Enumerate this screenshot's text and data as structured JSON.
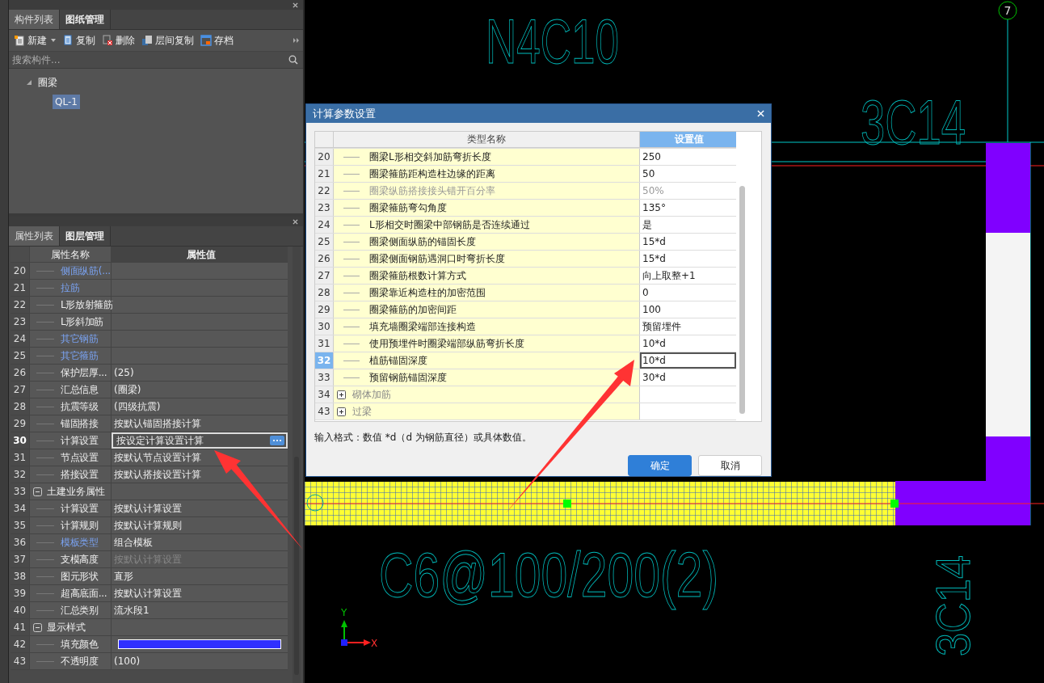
{
  "component_panel": {
    "tabs": [
      {
        "label": "构件列表",
        "selected": true
      },
      {
        "label": "图纸管理",
        "selected": false
      }
    ],
    "toolbar": [
      {
        "label": "新建",
        "kind": "new",
        "dropdown": true
      },
      {
        "label": "复制",
        "kind": "copy",
        "dropdown": false
      },
      {
        "label": "删除",
        "kind": "delete",
        "dropdown": false
      },
      {
        "label": "层间复制",
        "kind": "floor_copy",
        "dropdown": false
      },
      {
        "label": "存档",
        "kind": "archive",
        "dropdown": false
      }
    ],
    "search": {
      "placeholder": "搜索构件..."
    },
    "tree": [
      {
        "label": "圈梁",
        "expanded": true,
        "children": [
          {
            "label": "QL-1",
            "selected": true
          }
        ]
      }
    ]
  },
  "property_panel": {
    "tabs": [
      {
        "label": "属性列表",
        "selected": true
      },
      {
        "label": "图层管理",
        "selected": false
      }
    ],
    "columns": [
      "属性名称",
      "属性值"
    ],
    "rows": [
      {
        "index": "20",
        "kind": "child",
        "name": "侧面纵筋(...",
        "value": "",
        "link": true,
        "disabled": false,
        "selected": false
      },
      {
        "index": "21",
        "kind": "child",
        "name": "拉筋",
        "value": "",
        "link": true,
        "disabled": false,
        "selected": false
      },
      {
        "index": "22",
        "kind": "child",
        "name": "L形放射箍筋",
        "value": "",
        "link": false,
        "disabled": false,
        "selected": false
      },
      {
        "index": "23",
        "kind": "child",
        "name": "L形斜加筋",
        "value": "",
        "link": false,
        "disabled": false,
        "selected": false
      },
      {
        "index": "24",
        "kind": "child",
        "name": "其它钢筋",
        "value": "",
        "link": true,
        "disabled": false,
        "selected": false
      },
      {
        "index": "25",
        "kind": "child",
        "name": "其它箍筋",
        "value": "",
        "link": true,
        "disabled": false,
        "selected": false
      },
      {
        "index": "26",
        "kind": "child",
        "name": "保护层厚...",
        "value": "(25)",
        "link": false,
        "disabled": false,
        "selected": false
      },
      {
        "index": "27",
        "kind": "child",
        "name": "汇总信息",
        "value": "(圈梁)",
        "link": false,
        "disabled": false,
        "selected": false
      },
      {
        "index": "28",
        "kind": "child",
        "name": "抗震等级",
        "value": "(四级抗震)",
        "link": false,
        "disabled": false,
        "selected": false
      },
      {
        "index": "29",
        "kind": "child",
        "name": "锚固搭接",
        "value": "按默认锚固搭接计算",
        "link": false,
        "disabled": false,
        "selected": false
      },
      {
        "index": "30",
        "kind": "child",
        "name": "计算设置",
        "value": "按设定计算设置计算",
        "link": false,
        "disabled": false,
        "selected": true
      },
      {
        "index": "31",
        "kind": "child",
        "name": "节点设置",
        "value": "按默认节点设置计算",
        "link": false,
        "disabled": false,
        "selected": false
      },
      {
        "index": "32",
        "kind": "child",
        "name": "搭接设置",
        "value": "按默认搭接设置计算",
        "link": false,
        "disabled": false,
        "selected": false
      },
      {
        "index": "33",
        "kind": "group",
        "name": "土建业务属性",
        "value": "",
        "expanded": true,
        "selected": false
      },
      {
        "index": "34",
        "kind": "child",
        "name": "计算设置",
        "value": "按默认计算设置",
        "link": false,
        "disabled": false,
        "selected": false
      },
      {
        "index": "35",
        "kind": "child",
        "name": "计算规则",
        "value": "按默认计算规则",
        "link": false,
        "disabled": false,
        "selected": false
      },
      {
        "index": "36",
        "kind": "child",
        "name": "模板类型",
        "value": "组合模板",
        "link": true,
        "disabled": false,
        "selected": false
      },
      {
        "index": "37",
        "kind": "child",
        "name": "支模高度",
        "value": "按默认计算设置",
        "link": false,
        "disabled": true,
        "selected": false
      },
      {
        "index": "38",
        "kind": "child",
        "name": "图元形状",
        "value": "直形",
        "link": false,
        "disabled": false,
        "selected": false
      },
      {
        "index": "39",
        "kind": "child",
        "name": "超高底面...",
        "value": "按默认计算设置",
        "link": false,
        "disabled": false,
        "selected": false
      },
      {
        "index": "40",
        "kind": "child",
        "name": "汇总类别",
        "value": "流水段1",
        "link": false,
        "disabled": false,
        "selected": false
      },
      {
        "index": "41",
        "kind": "group",
        "name": "显示样式",
        "value": "",
        "expanded": true,
        "selected": false
      },
      {
        "index": "42",
        "kind": "color",
        "name": "填充颜色",
        "color": "#3030ff",
        "link": false,
        "selected": false
      },
      {
        "index": "43",
        "kind": "child",
        "name": "不透明度",
        "value": "(100)",
        "link": false,
        "disabled": false,
        "selected": false
      }
    ]
  },
  "canvas": {
    "labels": [
      {
        "text": "N4C10",
        "kind": "big"
      },
      {
        "text": "3C14",
        "kind": "medium"
      },
      {
        "text": "C6@100/200(2)",
        "kind": "beam"
      },
      {
        "text": "3C14",
        "kind": "vertical"
      }
    ],
    "axis_marker": "7",
    "axis_y": "Y",
    "axis_x": "X"
  },
  "dialog": {
    "title": "计算参数设置",
    "columns": [
      "类型名称",
      "设置值"
    ],
    "rows": [
      {
        "index": "20",
        "kind": "child",
        "name": "圈梁L形相交斜加筋弯折长度",
        "value": "250",
        "disabled": false,
        "selected": false
      },
      {
        "index": "21",
        "kind": "child",
        "name": "圈梁箍筋距构造柱边缘的距离",
        "value": "50",
        "disabled": false,
        "selected": false
      },
      {
        "index": "22",
        "kind": "child",
        "name": "圈梁纵筋搭接接头错开百分率",
        "value": "50%",
        "disabled": true,
        "selected": false
      },
      {
        "index": "23",
        "kind": "child",
        "name": "圈梁箍筋弯勾角度",
        "value": "135°",
        "disabled": false,
        "selected": false
      },
      {
        "index": "24",
        "kind": "child",
        "name": "L形相交时圈梁中部钢筋是否连续通过",
        "value": "是",
        "disabled": false,
        "selected": false
      },
      {
        "index": "25",
        "kind": "child",
        "name": "圈梁侧面纵筋的锚固长度",
        "value": "15*d",
        "disabled": false,
        "selected": false
      },
      {
        "index": "26",
        "kind": "child",
        "name": "圈梁侧面钢筋遇洞口时弯折长度",
        "value": "15*d",
        "disabled": false,
        "selected": false
      },
      {
        "index": "27",
        "kind": "child",
        "name": "圈梁箍筋根数计算方式",
        "value": "向上取整+1",
        "disabled": false,
        "selected": false
      },
      {
        "index": "28",
        "kind": "child",
        "name": "圈梁靠近构造柱的加密范围",
        "value": "0",
        "disabled": false,
        "selected": false
      },
      {
        "index": "29",
        "kind": "child",
        "name": "圈梁箍筋的加密间距",
        "value": "100",
        "disabled": false,
        "selected": false
      },
      {
        "index": "30",
        "kind": "child",
        "name": "填充墙圈梁端部连接构造",
        "value": "预留埋件",
        "disabled": false,
        "selected": false
      },
      {
        "index": "31",
        "kind": "child",
        "name": "使用预埋件时圈梁端部纵筋弯折长度",
        "value": "10*d",
        "disabled": false,
        "selected": false
      },
      {
        "index": "32",
        "kind": "child",
        "name": "植筋锚固深度",
        "value": "10*d",
        "disabled": false,
        "selected": true
      },
      {
        "index": "33",
        "kind": "child",
        "name": "预留钢筋锚固深度",
        "value": "30*d",
        "disabled": false,
        "selected": false
      },
      {
        "index": "34",
        "kind": "group",
        "name": "砌体加筋",
        "expanded": false,
        "selected": false
      },
      {
        "index": "43",
        "kind": "group",
        "name": "过梁",
        "expanded": false,
        "selected": false
      }
    ],
    "hint": "输入格式：数值 *d（d 为钢筋直径）或具体数值。",
    "buttons": [
      {
        "label": "确定",
        "kind": "primary"
      },
      {
        "label": "取消",
        "kind": "secondary"
      }
    ]
  }
}
